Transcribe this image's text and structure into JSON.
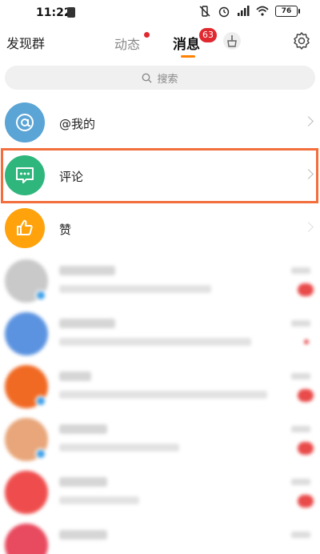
{
  "status_bar": {
    "time": "11:22",
    "battery": "76"
  },
  "header": {
    "left_title": "发现群",
    "tabs": [
      {
        "label": "动态"
      },
      {
        "label": "消息"
      }
    ],
    "message_badge": "63"
  },
  "search": {
    "placeholder": "搜索"
  },
  "rows": [
    {
      "label": "@我的",
      "avatar_color": "#5aa4d6",
      "icon": "at-icon"
    },
    {
      "label": "评论",
      "avatar_color": "#2fb67c",
      "icon": "comment-icon"
    },
    {
      "label": "赞",
      "avatar_color": "#ffa20c",
      "icon": "thumbs-up-icon"
    }
  ],
  "colors": {
    "accent": "#ff8200",
    "badge_red": "#e0282f",
    "highlight_border": "#f26f3d"
  }
}
